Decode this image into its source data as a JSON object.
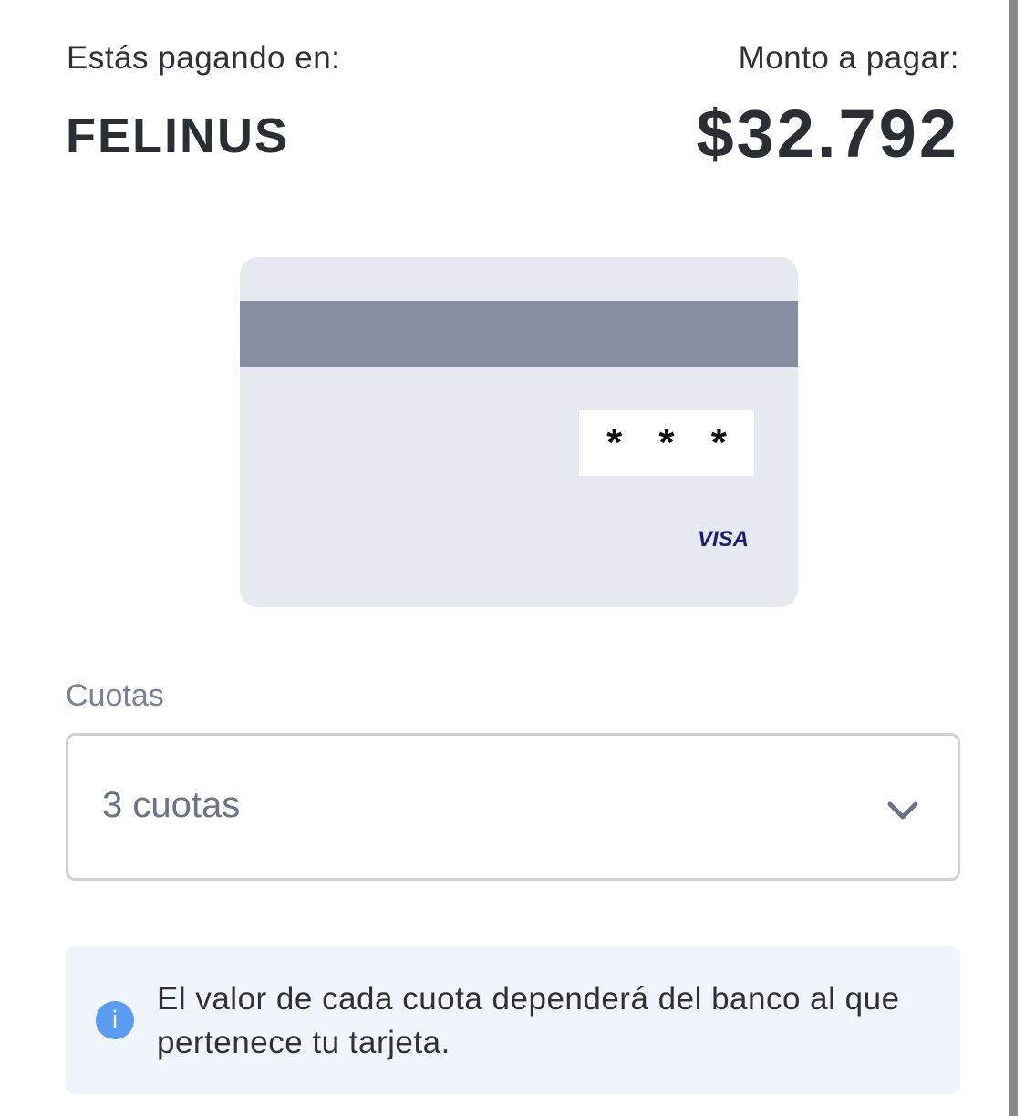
{
  "header": {
    "merchant_label": "Estás pagando en:",
    "merchant_name": "FELINUS",
    "amount_label": "Monto a pagar:",
    "amount_value": "$32.792"
  },
  "card": {
    "cvv_mask": "* * *",
    "brand": "VISA",
    "colors": {
      "card_background": "#e6e9f0",
      "magnetic_stripe": "#868ea2",
      "brand_text": "#1a1f71"
    }
  },
  "installments": {
    "label": "Cuotas",
    "selected_value": "3 cuotas",
    "icon": "chevron-down-icon"
  },
  "info": {
    "icon": "info-icon",
    "icon_glyph": "i",
    "message": "El valor de cada cuota dependerá del banco al que pertenece tu tarjeta.",
    "colors": {
      "background": "#f0f4fc",
      "icon": "#5a9cf2"
    }
  }
}
